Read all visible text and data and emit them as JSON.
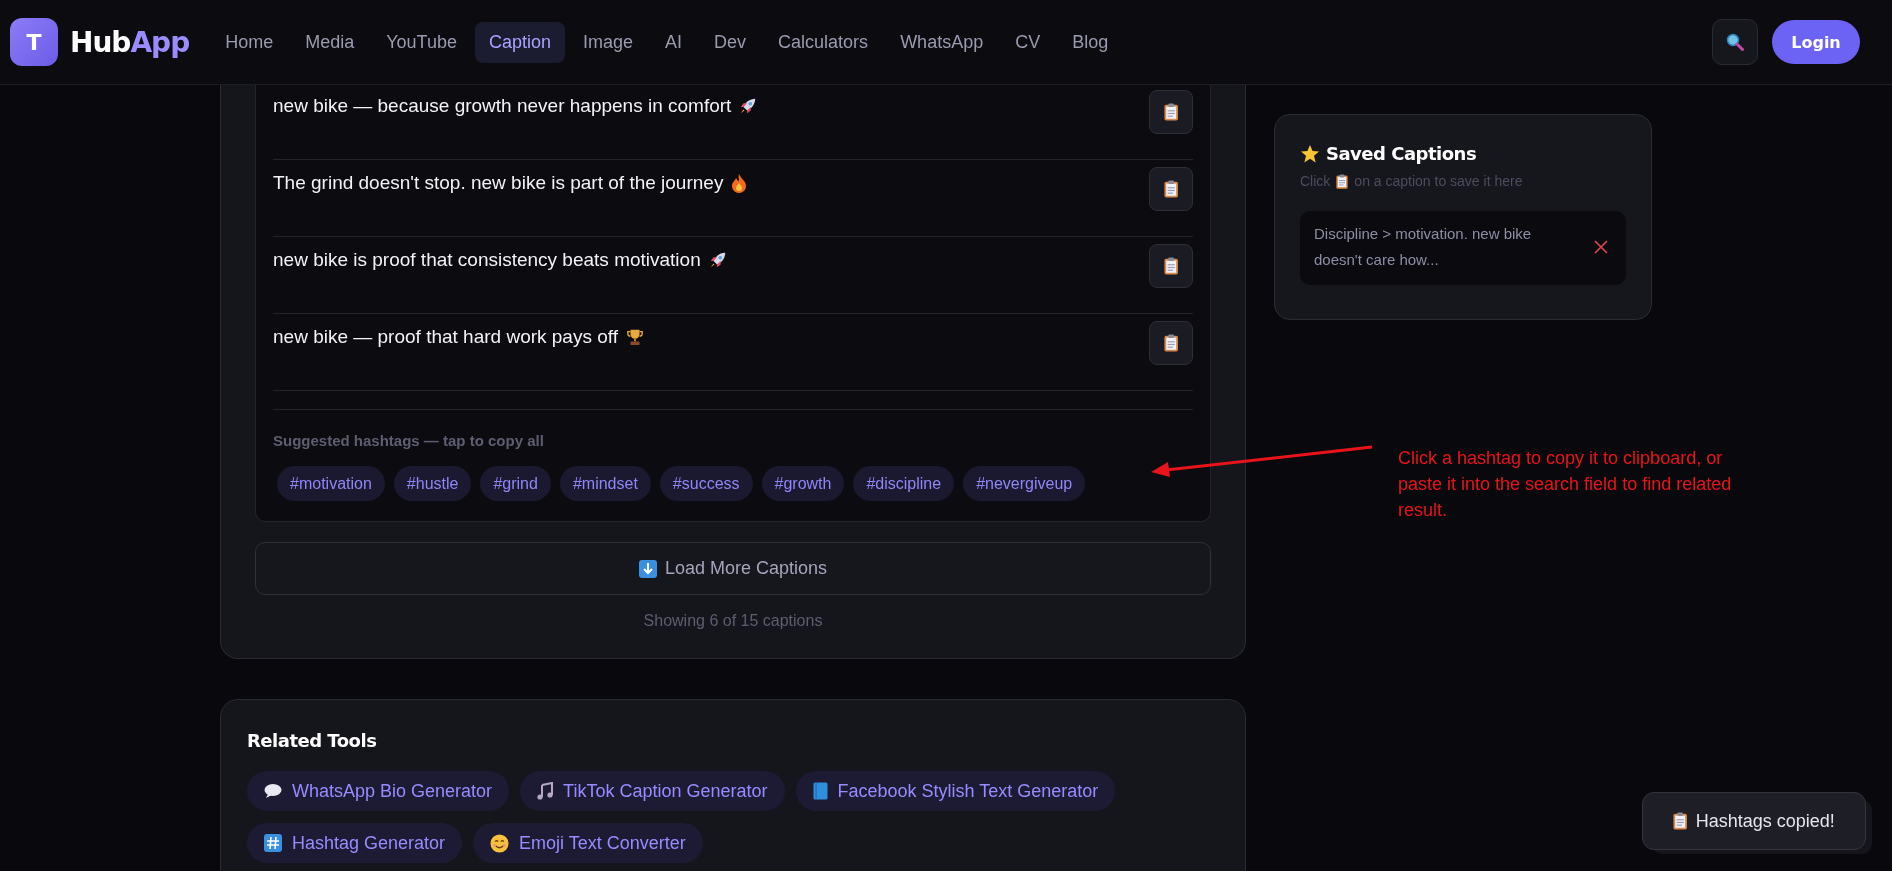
{
  "header": {
    "logo_letter": "T",
    "brand": "Hub",
    "brand_accent": "App",
    "login": "Login",
    "nav": [
      {
        "label": "Home",
        "selected": false
      },
      {
        "label": "Media",
        "selected": false
      },
      {
        "label": "YouTube",
        "selected": false
      },
      {
        "label": "Caption",
        "selected": true
      },
      {
        "label": "Image",
        "selected": false
      },
      {
        "label": "AI",
        "selected": false
      },
      {
        "label": "Dev",
        "selected": false
      },
      {
        "label": "Calculators",
        "selected": false
      },
      {
        "label": "WhatsApp",
        "selected": false
      },
      {
        "label": "CV",
        "selected": false
      },
      {
        "label": "Blog",
        "selected": false
      }
    ]
  },
  "captions": [
    "new bike — because growth never happens in comfort",
    "The grind doesn't stop. new bike is part of the journey",
    "new bike is proof that consistency beats motivation",
    "new bike — proof that hard work pays off"
  ],
  "hashtags": {
    "label": "Suggested hashtags — tap to copy all",
    "tags": [
      "#motivation",
      "#hustle",
      "#grind",
      "#mindset",
      "#success",
      "#growth",
      "#discipline",
      "#nevergiveup"
    ]
  },
  "load_more": "Load More Captions",
  "showing": "Showing 6 of 15 captions",
  "related": {
    "title": "Related Tools",
    "tools": [
      "WhatsApp Bio Generator",
      "TikTok Caption Generator",
      "Facebook Stylish Text Generator",
      "Hashtag Generator",
      "Emoji Text Converter"
    ]
  },
  "saved": {
    "title": "Saved Captions",
    "hint_before": "Click",
    "hint_after": "on a caption to save it here",
    "items": [
      "Discipline > motivation. new bike doesn't care how..."
    ]
  },
  "annotation": "Click a hashtag to copy it to clipboard, or paste it into the search field to find related result.",
  "toast": "Hashtags copied!"
}
